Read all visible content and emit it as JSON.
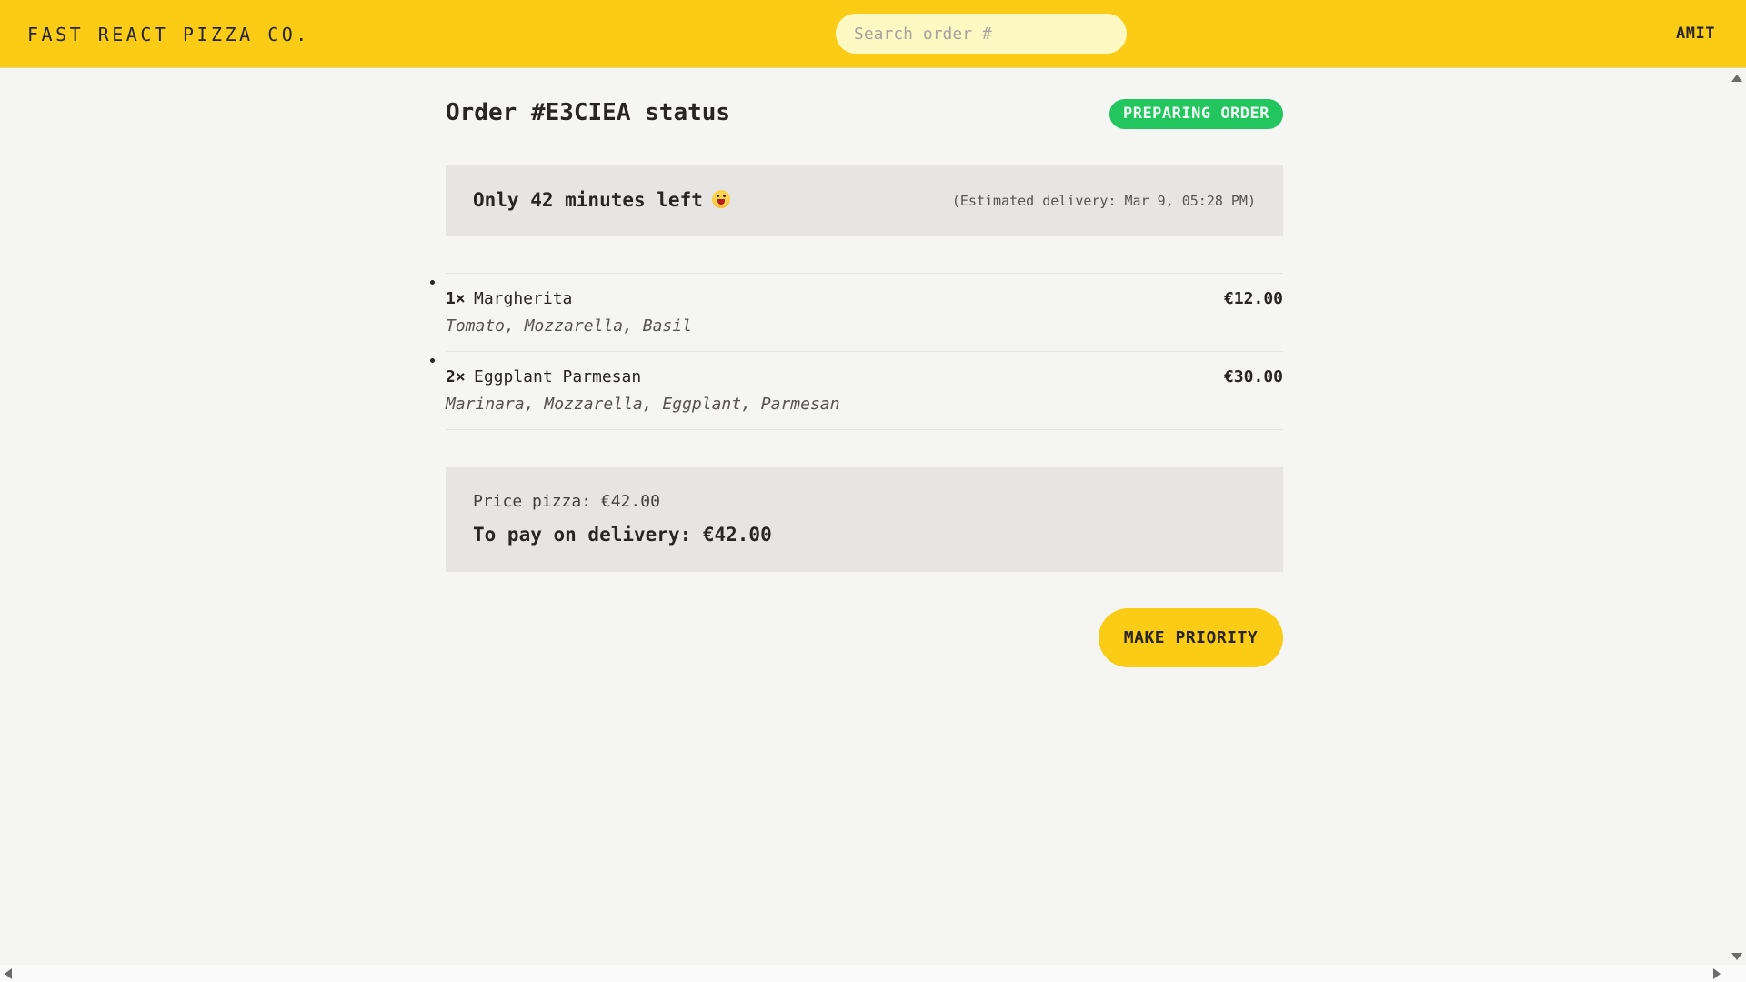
{
  "header": {
    "logo": "FAST REACT PIZZA CO.",
    "search_placeholder": "Search order #",
    "username": "AMIT"
  },
  "order": {
    "title": "Order #E3CIEA status",
    "status": "PREPARING ORDER",
    "time_left": "Only 42 minutes left",
    "emoji_icon": "face-with-open-mouth-emoji",
    "estimated_delivery": "(Estimated delivery: Mar 9, 05:28 PM)",
    "items": [
      {
        "qty": "1×",
        "name": "Margherita",
        "price": "€12.00",
        "ingredients": "Tomato, Mozzarella, Basil"
      },
      {
        "qty": "2×",
        "name": "Eggplant Parmesan",
        "price": "€30.00",
        "ingredients": "Marinara, Mozzarella, Eggplant, Parmesan"
      }
    ],
    "price_pizza": "Price pizza: €42.00",
    "to_pay": "To pay on delivery: €42.00",
    "priority_button": "MAKE PRIORITY"
  },
  "colors": {
    "header_bg": "#facc15",
    "status_badge": "#22c55e",
    "page_bg": "#f5f5f4",
    "panel_bg": "#e7e5e4"
  }
}
